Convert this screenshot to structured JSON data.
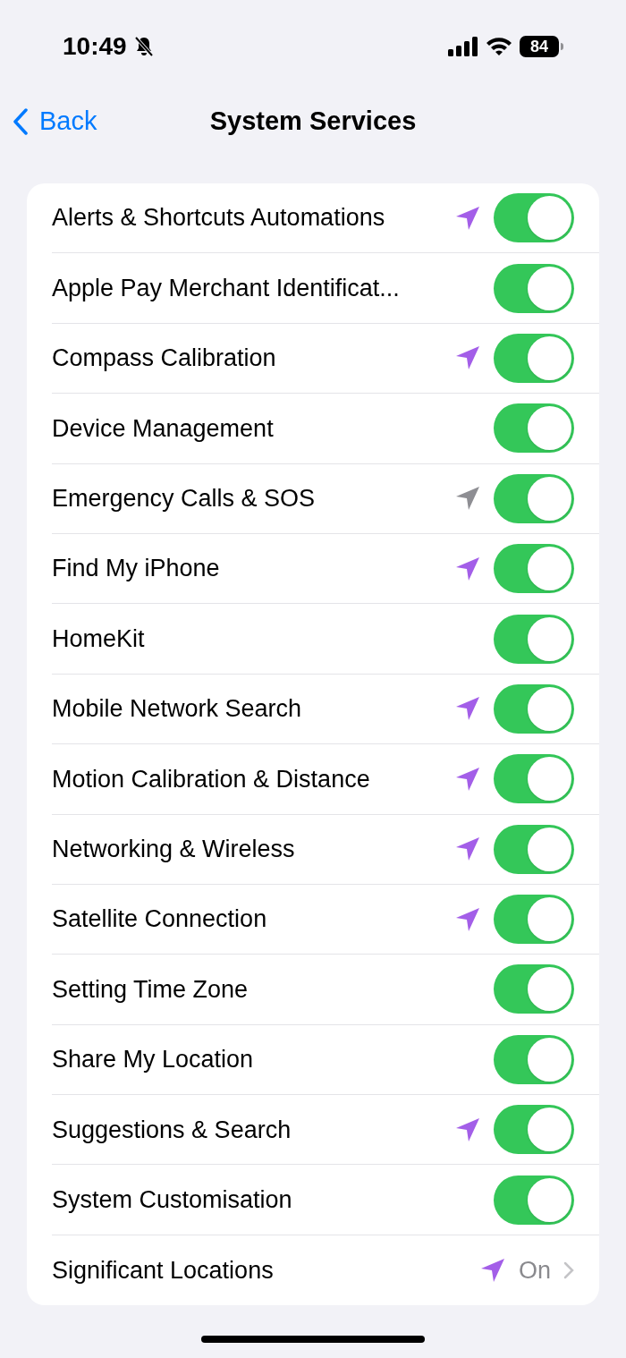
{
  "status_bar": {
    "time": "10:49",
    "battery": "84"
  },
  "nav": {
    "back": "Back",
    "title": "System Services"
  },
  "rows": [
    {
      "kind": "toggle",
      "label": "Alerts & Shortcuts Automations",
      "color": "#a35ee8",
      "on": true
    },
    {
      "kind": "toggle",
      "label": "Apple Pay Merchant Identificat...",
      "on": true
    },
    {
      "kind": "toggle",
      "label": "Compass Calibration",
      "color": "#a35ee8",
      "on": true
    },
    {
      "kind": "toggle",
      "label": "Device Management",
      "on": true
    },
    {
      "kind": "toggle",
      "label": "Emergency Calls & SOS",
      "color": "#8e8e93",
      "on": true
    },
    {
      "kind": "toggle",
      "label": "Find My iPhone",
      "color": "#a35ee8",
      "on": true
    },
    {
      "kind": "toggle",
      "label": "HomeKit",
      "on": true
    },
    {
      "kind": "toggle",
      "label": "Mobile Network Search",
      "color": "#a35ee8",
      "on": true
    },
    {
      "kind": "toggle",
      "label": "Motion Calibration & Distance",
      "color": "#a35ee8",
      "on": true
    },
    {
      "kind": "toggle",
      "label": "Networking & Wireless",
      "color": "#a35ee8",
      "on": true
    },
    {
      "kind": "toggle",
      "label": "Satellite Connection",
      "color": "#a35ee8",
      "on": true
    },
    {
      "kind": "toggle",
      "label": "Setting Time Zone",
      "on": true
    },
    {
      "kind": "toggle",
      "label": "Share My Location",
      "on": true
    },
    {
      "kind": "toggle",
      "label": "Suggestions & Search",
      "color": "#a35ee8",
      "on": true
    },
    {
      "kind": "toggle",
      "label": "System Customisation",
      "on": true
    },
    {
      "kind": "link",
      "label": "Significant Locations",
      "color": "#a35ee8",
      "value": "On"
    }
  ]
}
